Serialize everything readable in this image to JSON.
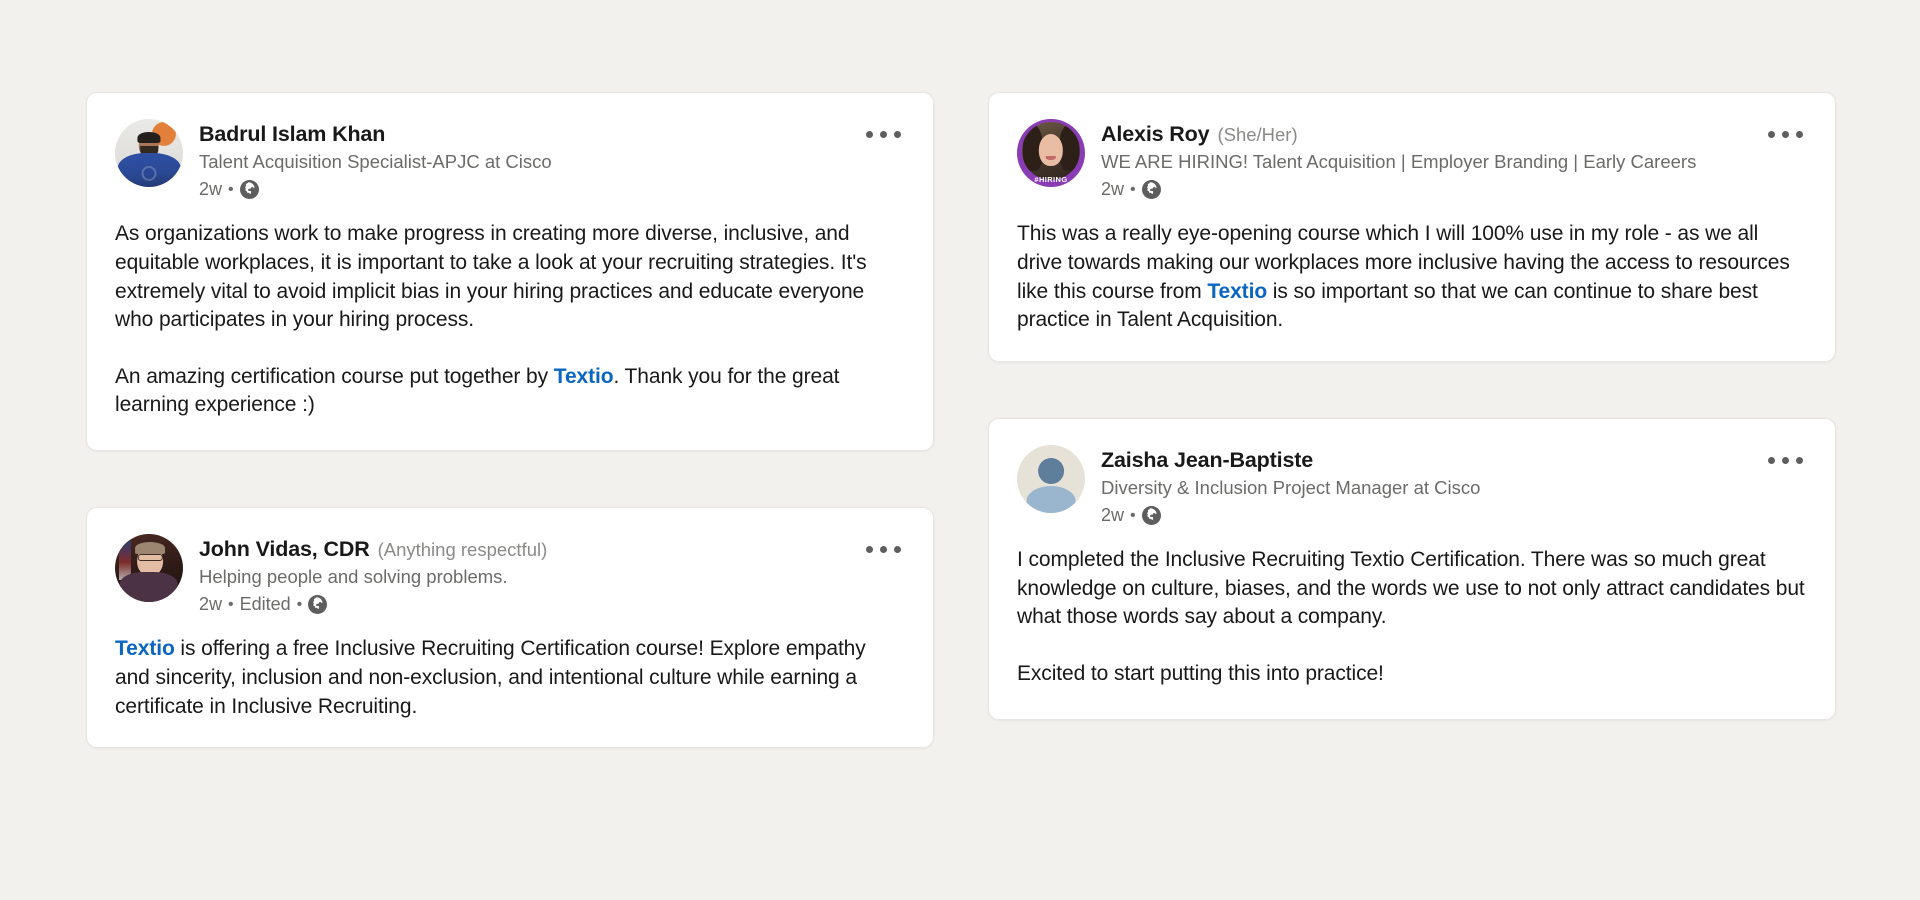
{
  "theme": {
    "page_background": "#f2f1ee",
    "card_background": "#ffffff",
    "text_primary": "#191919",
    "text_secondary": "#6b6b69",
    "link_accent": "#0a66c2",
    "hiring_frame": "#8a3cb4"
  },
  "icons": {
    "globe": "globe-icon",
    "overflow_menu": "ellipsis-icon"
  },
  "labels": {
    "hiring_frame_text": "#HIRING",
    "meta_separator": "•"
  },
  "columns": {
    "left": [
      {
        "author": "Badrul Islam Khan",
        "pronouns": "",
        "headline": "Talent Acquisition Specialist-APJC at Cisco",
        "timestamp": "2w",
        "edited": "",
        "visibility": "globe-icon",
        "avatar_kind": "photo-man-blue-shirt",
        "hiring_frame": false,
        "paragraphs": [
          [
            {
              "t": "As organizations work to make progress in creating more diverse, inclusive, and equitable workplaces, it is important to take a look at your recruiting strategies. It's extremely vital to avoid implicit bias in your hiring practices and educate everyone who participates in your hiring process.",
              "link": false
            }
          ],
          [
            {
              "t": "An amazing certification course put together by ",
              "link": false
            },
            {
              "t": "Textio",
              "link": true
            },
            {
              "t": ". Thank you for the great learning experience :)",
              "link": false
            }
          ]
        ]
      },
      {
        "author": "John Vidas, CDR",
        "pronouns": "(Anything respectful)",
        "headline": "Helping people and solving problems.",
        "timestamp": "2w",
        "edited": "Edited",
        "visibility": "globe-icon",
        "avatar_kind": "photo-person-glasses",
        "hiring_frame": false,
        "paragraphs": [
          [
            {
              "t": "Textio",
              "link": true
            },
            {
              "t": " is offering a free Inclusive Recruiting Certification course! Explore empathy and sincerity, inclusion and non-exclusion, and intentional culture while earning a certificate in Inclusive Recruiting.",
              "link": false
            }
          ]
        ]
      }
    ],
    "right": [
      {
        "author": "Alexis Roy",
        "pronouns": "(She/Her)",
        "headline": "WE ARE HIRING! Talent Acquisition | Employer Branding | Early Careers",
        "timestamp": "2w",
        "edited": "",
        "visibility": "globe-icon",
        "avatar_kind": "photo-woman-smiling",
        "hiring_frame": true,
        "paragraphs": [
          [
            {
              "t": "This was a really eye-opening course which I will 100% use in my role - as we all drive towards making our workplaces more inclusive having the access to resources like this course from ",
              "link": false
            },
            {
              "t": "Textio",
              "link": true
            },
            {
              "t": " is so important so that we can continue to share best practice in Talent Acquisition.",
              "link": false
            }
          ]
        ]
      },
      {
        "author": "Zaisha Jean-Baptiste",
        "pronouns": "",
        "headline": "Diversity & Inclusion Project Manager at Cisco",
        "timestamp": "2w",
        "edited": "",
        "visibility": "globe-icon",
        "avatar_kind": "default-placeholder",
        "hiring_frame": false,
        "paragraphs": [
          [
            {
              "t": "I completed the Inclusive Recruiting Textio Certification. There was so much great knowledge on culture, biases, and the words we use to not only attract candidates but what those words say about a company.",
              "link": false
            }
          ],
          [
            {
              "t": "Excited to start putting this into practice!",
              "link": false
            }
          ]
        ]
      }
    ]
  }
}
